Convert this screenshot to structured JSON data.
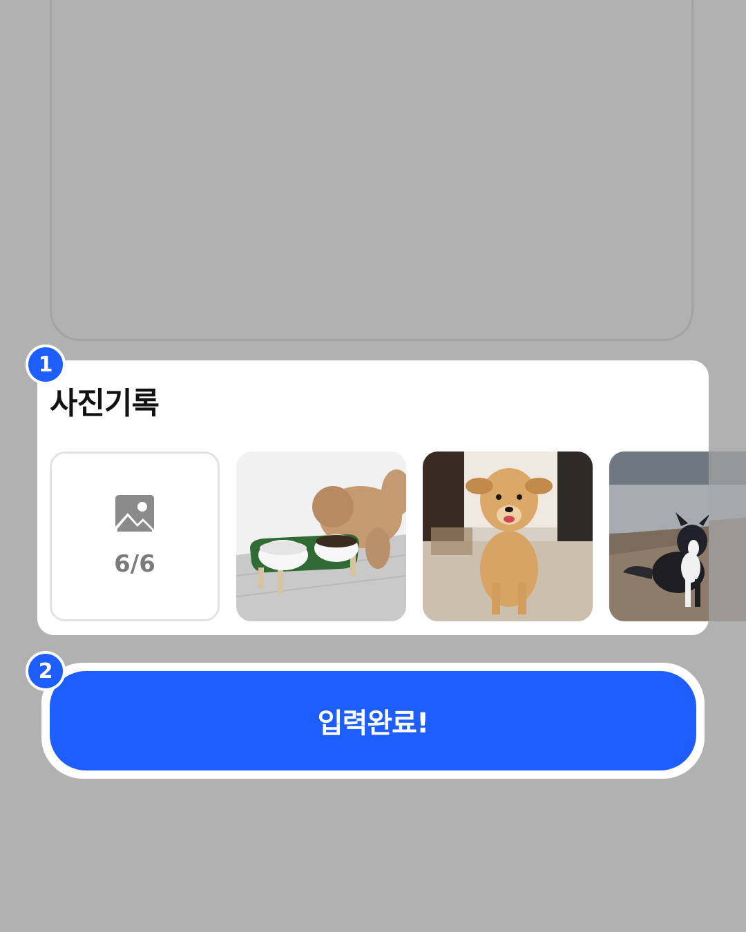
{
  "photo_section": {
    "title": "사진기록",
    "add_tile": {
      "icon": "image-icon",
      "count": "6/6"
    },
    "photos": [
      {
        "name": "dog-eating-from-bowl-photo"
      },
      {
        "name": "dog-sitting-indoors-photo"
      },
      {
        "name": "dog-on-beach-photo"
      }
    ]
  },
  "badges": {
    "step1": "1",
    "step2": "2"
  },
  "submit": {
    "label": "입력완료!"
  },
  "colors": {
    "accent": "#1f5efe",
    "overlay": "#b1b1b1",
    "card": "#ffffff",
    "muted_text": "#7b7b7b"
  }
}
